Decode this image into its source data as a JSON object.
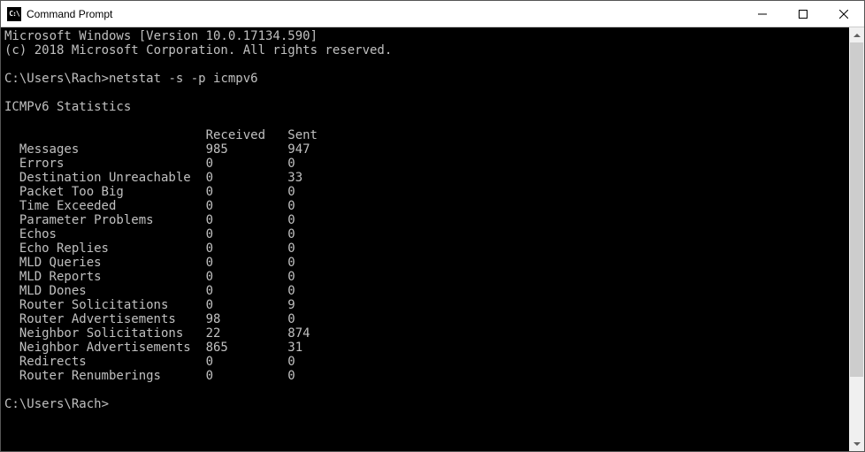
{
  "window": {
    "title": "Command Prompt"
  },
  "terminal": {
    "line1": "Microsoft Windows [Version 10.0.17134.590]",
    "line2": "(c) 2018 Microsoft Corporation. All rights reserved.",
    "prompt1": "C:\\Users\\Rach>",
    "command": "netstat -s -p icmpv6",
    "stats_title": "ICMPv6 Statistics",
    "header_received": "Received",
    "header_sent": "Sent",
    "rows": [
      {
        "label": "Messages",
        "received": "985",
        "sent": "947"
      },
      {
        "label": "Errors",
        "received": "0",
        "sent": "0"
      },
      {
        "label": "Destination Unreachable",
        "received": "0",
        "sent": "33"
      },
      {
        "label": "Packet Too Big",
        "received": "0",
        "sent": "0"
      },
      {
        "label": "Time Exceeded",
        "received": "0",
        "sent": "0"
      },
      {
        "label": "Parameter Problems",
        "received": "0",
        "sent": "0"
      },
      {
        "label": "Echos",
        "received": "0",
        "sent": "0"
      },
      {
        "label": "Echo Replies",
        "received": "0",
        "sent": "0"
      },
      {
        "label": "MLD Queries",
        "received": "0",
        "sent": "0"
      },
      {
        "label": "MLD Reports",
        "received": "0",
        "sent": "0"
      },
      {
        "label": "MLD Dones",
        "received": "0",
        "sent": "0"
      },
      {
        "label": "Router Solicitations",
        "received": "0",
        "sent": "9"
      },
      {
        "label": "Router Advertisements",
        "received": "98",
        "sent": "0"
      },
      {
        "label": "Neighbor Solicitations",
        "received": "22",
        "sent": "874"
      },
      {
        "label": "Neighbor Advertisements",
        "received": "865",
        "sent": "31"
      },
      {
        "label": "Redirects",
        "received": "0",
        "sent": "0"
      },
      {
        "label": "Router Renumberings",
        "received": "0",
        "sent": "0"
      }
    ],
    "prompt2": "C:\\Users\\Rach>"
  }
}
